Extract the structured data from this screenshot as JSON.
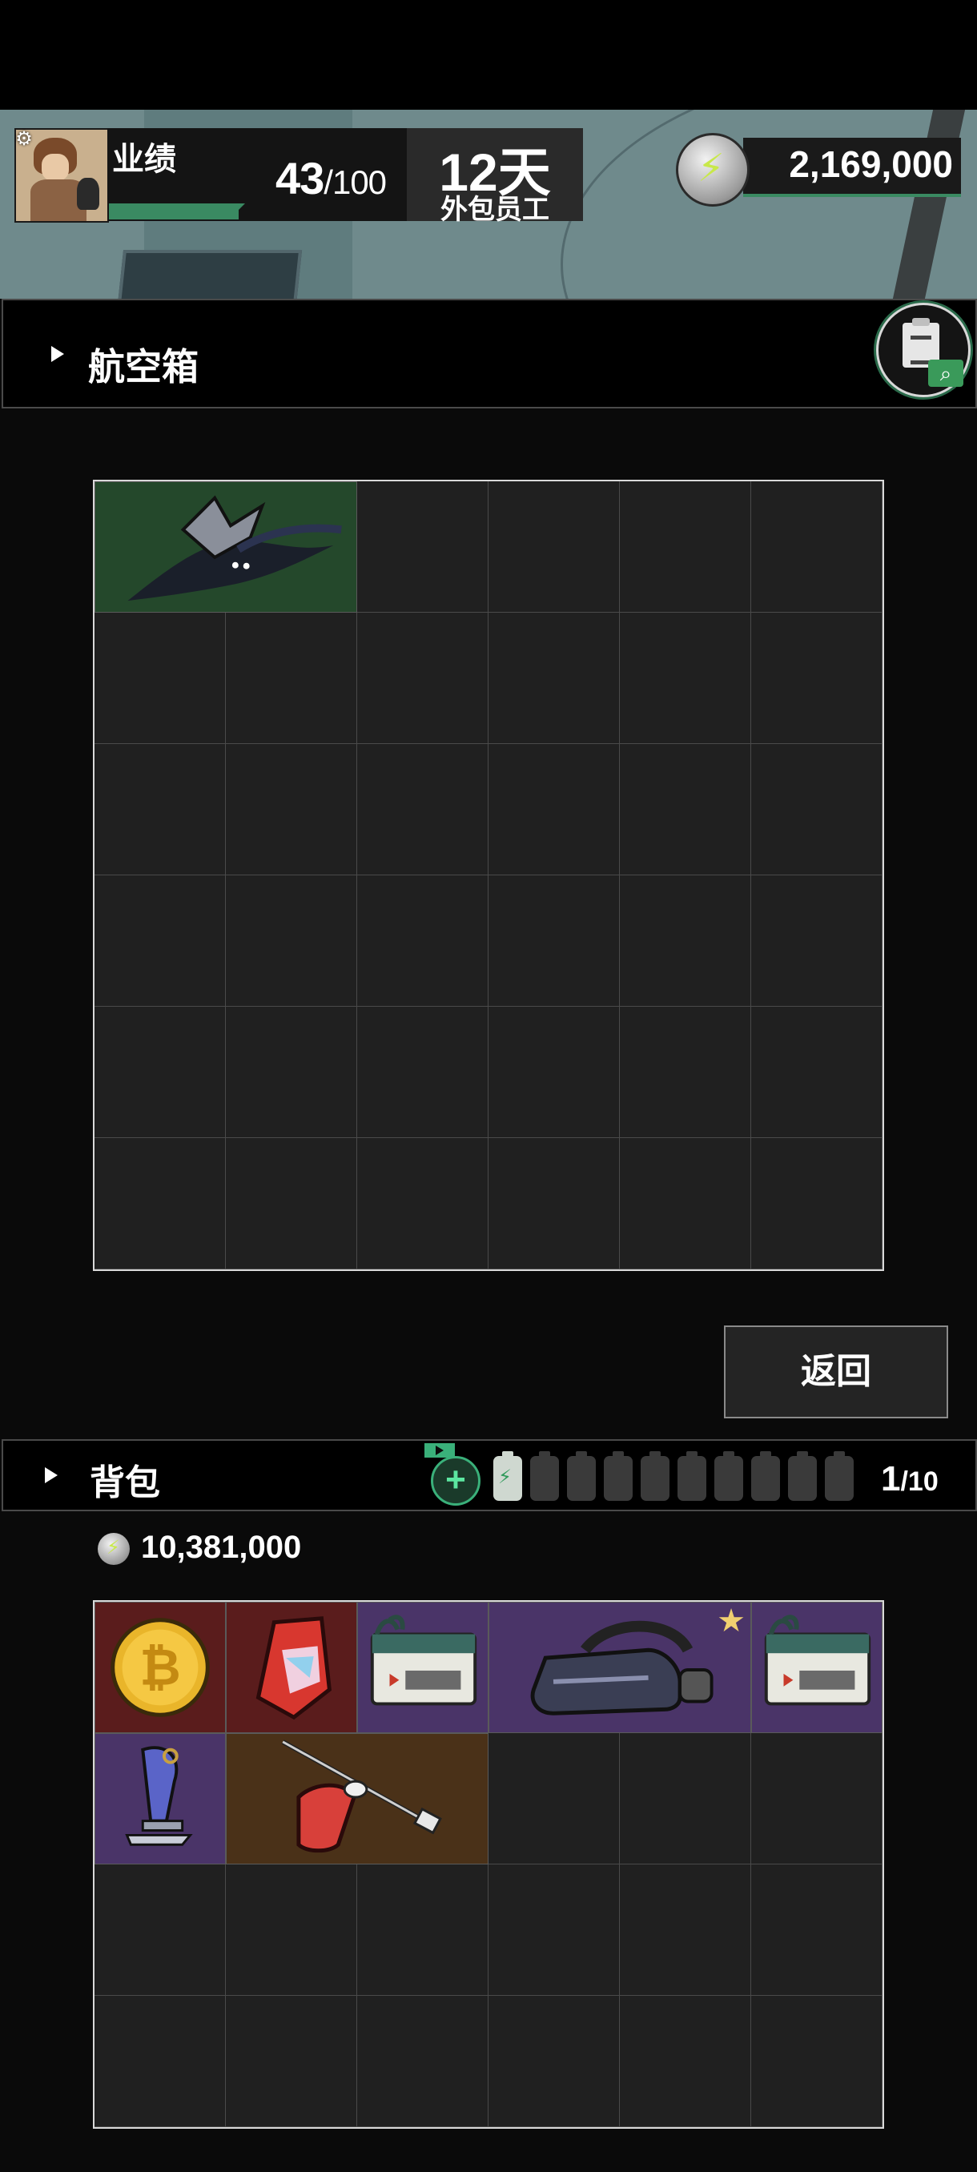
{
  "header": {
    "kpi_label": "业绩",
    "kpi_current": "43",
    "kpi_max": "/100",
    "days_value": "12天",
    "days_label": "外包员工",
    "currency": "2,169,000"
  },
  "aircase": {
    "title": "航空箱",
    "items": [
      {
        "name": "dark-scarf-item",
        "col": 1,
        "row": 1,
        "w": 2,
        "h": 1,
        "rarity": "green"
      }
    ]
  },
  "back_button": "返回",
  "backpack": {
    "title": "背包",
    "battery_full": 1,
    "battery_total": 10,
    "count": "1",
    "count_max": "/10",
    "money": "10,381,000",
    "items": [
      {
        "name": "bitcoin-coin-item",
        "col": 1,
        "row": 1,
        "w": 1,
        "h": 1,
        "rarity": "red"
      },
      {
        "name": "prism-crystal-item",
        "col": 2,
        "row": 1,
        "w": 1,
        "h": 1,
        "rarity": "red"
      },
      {
        "name": "postcard-item",
        "col": 3,
        "row": 1,
        "w": 1,
        "h": 1,
        "rarity": "purple"
      },
      {
        "name": "vr-headset-item",
        "col": 4,
        "row": 1,
        "w": 2,
        "h": 1,
        "rarity": "purple",
        "starred": true
      },
      {
        "name": "postcard-item",
        "col": 6,
        "row": 1,
        "w": 1,
        "h": 1,
        "rarity": "purple"
      },
      {
        "name": "figurine-keychain-item",
        "col": 1,
        "row": 2,
        "w": 1,
        "h": 1,
        "rarity": "purple"
      },
      {
        "name": "red-bag-tool-item",
        "col": 2,
        "row": 2,
        "w": 2,
        "h": 1,
        "rarity": "brown"
      }
    ]
  },
  "colors": {
    "accent_green": "#3a8a62",
    "rarity_green": "#24482b",
    "rarity_red": "#5a1c1c",
    "rarity_purple": "#4a3468",
    "rarity_brown": "#4a3118"
  }
}
